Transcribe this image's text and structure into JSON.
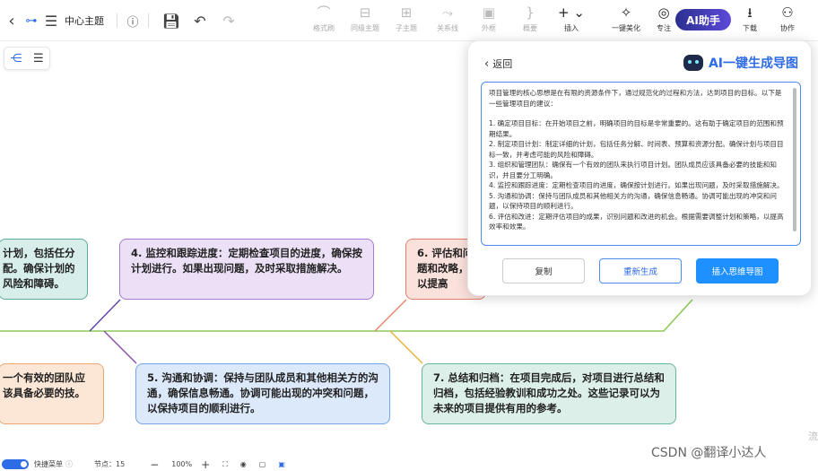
{
  "toolbar": {
    "title": "中心主题",
    "tools": [
      {
        "label": "格式刷",
        "icon": "format-painter-icon",
        "glyph": "⌒"
      },
      {
        "label": "同级主题",
        "icon": "sibling-topic-icon",
        "glyph": "⊟"
      },
      {
        "label": "子主题",
        "icon": "subtopic-icon",
        "glyph": "⊞"
      },
      {
        "label": "关系线",
        "icon": "relation-line-icon",
        "glyph": "⤳"
      },
      {
        "label": "外框",
        "icon": "boundary-icon",
        "glyph": "▣"
      },
      {
        "label": "概要",
        "icon": "summary-icon",
        "glyph": "}"
      },
      {
        "label": "插入",
        "icon": "insert-icon",
        "glyph": "+ ⌄"
      }
    ],
    "right_tools": [
      {
        "label": "一键美化",
        "icon": "magic-wand-icon",
        "glyph": "✧"
      },
      {
        "label": "专注",
        "icon": "focus-icon",
        "glyph": "◎"
      },
      {
        "label": "下载",
        "icon": "download-icon",
        "glyph": "⭳"
      },
      {
        "label": "协作",
        "icon": "collaborate-icon",
        "glyph": "⚇"
      }
    ],
    "ai_button": "AI助手"
  },
  "nodes": {
    "n3": "计划，包括任分配。确保计划的风险和障碍。",
    "n4": "4. 监控和跟踪进度：定期检查项目的进度，确保按计划进行。如果出现问题，及时采取措施解决。",
    "n6": "6. 评估和问题和改略，以提高",
    "n2": "一个有效的团队应该具备必要的技。",
    "n5": "5. 沟通和协调：保持与团队成员和其他相关方的沟通，确保信息畅通。协调可能出现的冲突和问题，以保持项目的顺利进行。",
    "n7": "7. 总结和归档：在项目完成后，对项目进行总结和归档，包括经验教训和成功之处。这些记录可以为未来的项目提供有用的参考。"
  },
  "panel": {
    "back": "返回",
    "title": "AI一键生成导图",
    "paragraphs": [
      "项目管理的核心思想是在有限的资源条件下，通过规范化的过程和方法，达到项目的目标。以下是一些管理项目的建议：",
      "1. 确定项目目标：在开始项目之前，明确项目的目标是非常重要的。这有助于确定项目的范围和预期结果。",
      "2. 制定项目计划：制定详细的计划，包括任务分解、时间表、预算和资源分配。确保计划与项目目标一致，并考虑可能的风险和障碍。",
      "3. 组织和管理团队：确保有一个有效的团队来执行项目计划。团队成员应该具备必要的技能和知识，并且要分工明确。",
      "4. 监控和跟踪进度：定期检查项目的进度，确保按计划进行。如果出现问题，及时采取措施解决。",
      "5. 沟通和协调：保持与团队成员和其他相关方的沟通，确保信息畅通。协调可能出现的冲突和问题，以保持项目的顺利进行。",
      "6. 评估和改进：定期评估项目的成果，识别问题和改进的机会。根据需要调整计划和策略，以提高效率和效果。"
    ],
    "buttons": [
      "复制",
      "重新生成",
      "插入思维导图"
    ]
  },
  "status": {
    "shortcut": "快捷菜单",
    "nodes": "节点：15",
    "zoom": "100%"
  },
  "watermark": "CSDN @翻译小达人",
  "edge_text": "流"
}
